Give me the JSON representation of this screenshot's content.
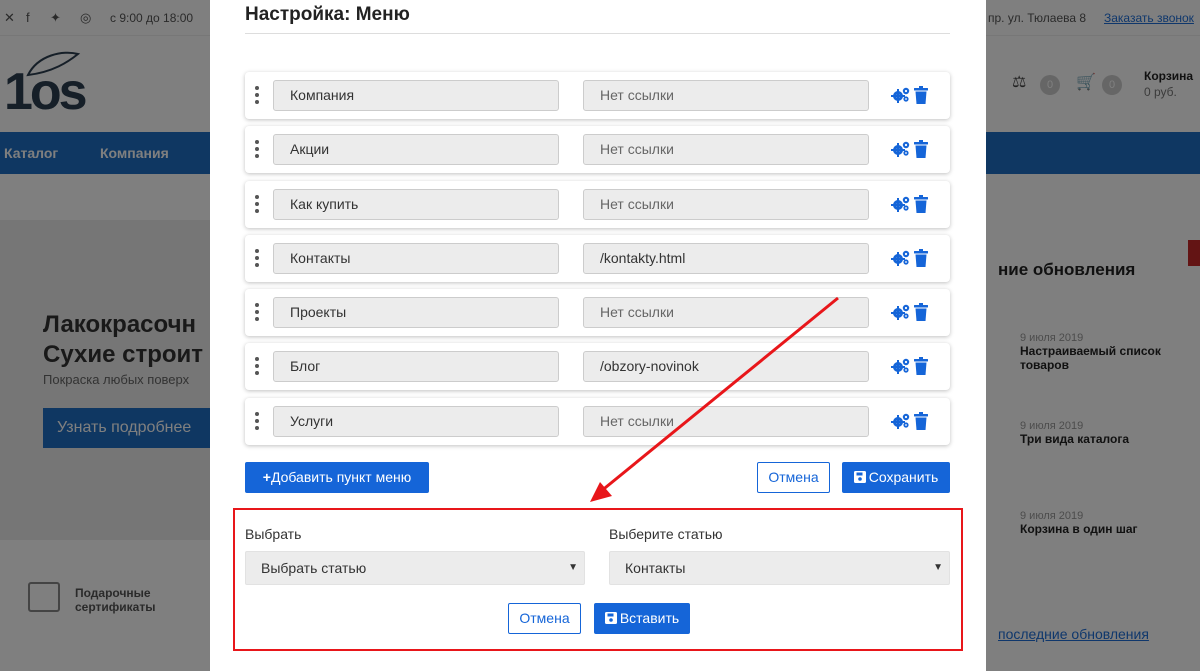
{
  "background": {
    "topbar": {
      "hours": "с 9:00 до 18:00",
      "address": "пр. ул. Тюлаева 8",
      "call_link": "Заказать звонок"
    },
    "logo_text": "1os",
    "cart": {
      "label": "Корзина",
      "sum": "0 руб.",
      "compare_count": "0",
      "cart_count": "0"
    },
    "nav": {
      "items": [
        "Каталог",
        "Компания"
      ]
    },
    "banner": {
      "title_line1": "Лакокрасочн",
      "title_line2": "Сухие строит",
      "subtitle": "Покраска любых поверх",
      "button": "Узнать подробнее"
    },
    "sidebar": {
      "heading": "ние обновления",
      "news": [
        {
          "date": "9 июля 2019",
          "title": "Настраиваемый список товаров"
        },
        {
          "date": "9 июля 2019",
          "title": "Три вида каталога"
        },
        {
          "date": "9 июля 2019",
          "title": "Корзина в один шаг"
        }
      ],
      "all_news": "последние обновления"
    },
    "gift": {
      "line1": "Подарочные",
      "line2": "сертификаты"
    }
  },
  "modal": {
    "title": "Настройка: Меню",
    "rows": [
      {
        "name": "Компания",
        "link": "Нет ссылки",
        "has_link": false
      },
      {
        "name": "Акции",
        "link": "Нет ссылки",
        "has_link": false
      },
      {
        "name": "Как купить",
        "link": "Нет ссылки",
        "has_link": false
      },
      {
        "name": "Контакты",
        "link": "/kontakty.html",
        "has_link": true
      },
      {
        "name": "Проекты",
        "link": "Нет ссылки",
        "has_link": false
      },
      {
        "name": "Блог",
        "link": "/obzory-novinok",
        "has_link": true
      },
      {
        "name": "Услуги",
        "link": "Нет ссылки",
        "has_link": false
      }
    ],
    "add_button": "Добавить пункт меню",
    "cancel_button": "Отмена",
    "save_button": "Сохранить",
    "insert_panel": {
      "select1_label": "Выбрать",
      "select1_value": "Выбрать статью",
      "select2_label": "Выберите статью",
      "select2_value": "Контакты",
      "cancel_button": "Отмена",
      "insert_button": "Вставить"
    }
  },
  "colors": {
    "primary_blue": "#1565d8",
    "nav_blue": "#1f6fc5",
    "highlight_red": "#e8161a"
  },
  "icons": [
    "cog-icon",
    "trash-icon",
    "drag-handle-icon",
    "save-icon",
    "plus-icon",
    "dropdown-caret-icon",
    "annotation-arrow"
  ]
}
